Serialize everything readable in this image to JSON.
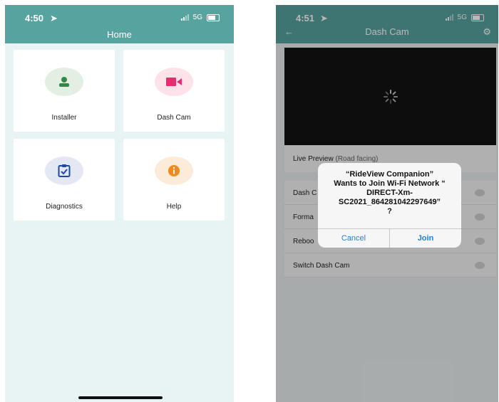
{
  "home_screen": {
    "status_time": "4:50",
    "status_network": "5G",
    "title": "Home",
    "tiles": [
      {
        "label": "Installer",
        "icon": "person-icon",
        "circle_color": "#e2efe2",
        "icon_color": "#2e8b47"
      },
      {
        "label": "Dash Cam",
        "icon": "video-camera-icon",
        "circle_color": "#fde2ea",
        "icon_color": "#e72c72"
      },
      {
        "label": "Diagnostics",
        "icon": "clipboard-check-icon",
        "circle_color": "#e3e8f4",
        "icon_color": "#1f49a6"
      },
      {
        "label": "Help",
        "icon": "info-icon",
        "circle_color": "#fdebd9",
        "icon_color": "#f08a1f"
      }
    ]
  },
  "dashcam_screen": {
    "status_time": "4:51",
    "status_network": "5G",
    "title": "Dash Cam",
    "preview_label": "Live Preview",
    "preview_sublabel": "(Road facing)",
    "rows": [
      "Dash C",
      "Forma",
      "Reboo",
      "Switch Dash Cam"
    ],
    "dialog": {
      "message": "“RideView Companion”\nWants to Join Wi-Fi Network “\nDIRECT-Xm-\nSC2021_864281042297649”\n?",
      "cancel_label": "Cancel",
      "join_label": "Join"
    }
  },
  "colors": {
    "header": "#56a39f",
    "dialog_button": "#2a7ad6"
  }
}
